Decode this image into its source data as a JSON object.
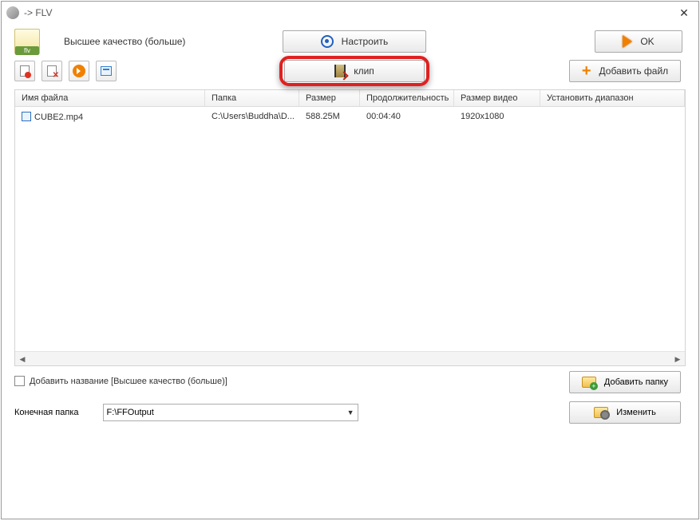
{
  "title": "  -> FLV",
  "quality_label": "Высшее качество (больше)",
  "buttons": {
    "settings": "Настроить",
    "ok": "OK",
    "clip": "клип",
    "add_file": "Добавить файл",
    "add_folder": "Добавить папку",
    "change": "Изменить"
  },
  "columns": {
    "filename": "Имя файла",
    "folder": "Папка",
    "size": "Размер",
    "duration": "Продолжительность",
    "vsize": "Размер видео",
    "range": "Установить диапазон"
  },
  "rows": [
    {
      "filename": "CUBE2.mp4",
      "folder": "C:\\Users\\Buddha\\D...",
      "size": "588.25M",
      "duration": "00:04:40",
      "vsize": "1920x1080",
      "range": ""
    }
  ],
  "add_title_checkbox": "Добавить название [Высшее качество (больше)]",
  "dest_label": "Конечная папка",
  "dest_value": "F:\\FFOutput"
}
